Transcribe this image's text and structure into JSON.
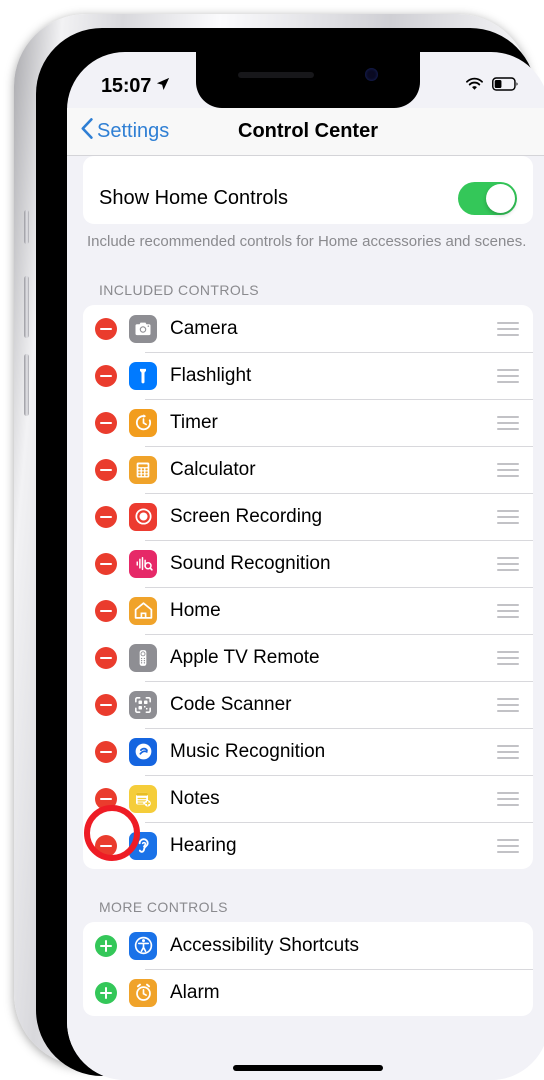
{
  "status_bar": {
    "time": "15:07",
    "location_icon": "location-arrow-icon",
    "wifi_icon": "wifi-icon",
    "battery_icon": "battery-icon",
    "battery_level_pct": 32
  },
  "nav": {
    "back_label": "Settings",
    "back_icon": "chevron-left-icon",
    "title": "Control Center"
  },
  "home_controls": {
    "label": "Show Home Controls",
    "toggle_state": "on",
    "toggle_color": "#34c759",
    "footer": "Include recommended controls for Home accessories and scenes."
  },
  "included_controls": {
    "header": "INCLUDED CONTROLS",
    "items": [
      {
        "label": "Camera",
        "icon": "camera-icon",
        "icon_color": "#8e8e93",
        "action": "remove"
      },
      {
        "label": "Flashlight",
        "icon": "flashlight-icon",
        "icon_color": "#007aff",
        "action": "remove"
      },
      {
        "label": "Timer",
        "icon": "timer-icon",
        "icon_color": "#f29d1e",
        "action": "remove"
      },
      {
        "label": "Calculator",
        "icon": "calculator-icon",
        "icon_color": "#f0a32a",
        "action": "remove"
      },
      {
        "label": "Screen Recording",
        "icon": "screen-recording-icon",
        "icon_color": "#ec3b30",
        "action": "remove"
      },
      {
        "label": "Sound Recognition",
        "icon": "sound-recognition-icon",
        "icon_color": "#e62968",
        "action": "remove"
      },
      {
        "label": "Home",
        "icon": "home-icon",
        "icon_color": "#f0a32a",
        "action": "remove"
      },
      {
        "label": "Apple TV Remote",
        "icon": "apple-tv-remote-icon",
        "icon_color": "#8e8e93",
        "action": "remove"
      },
      {
        "label": "Code Scanner",
        "icon": "code-scanner-icon",
        "icon_color": "#8e8e93",
        "action": "remove"
      },
      {
        "label": "Music Recognition",
        "icon": "music-recognition-icon",
        "icon_color": "#1565e0",
        "action": "remove"
      },
      {
        "label": "Notes",
        "icon": "notes-icon",
        "icon_color": "#f5cd3a",
        "action": "remove"
      },
      {
        "label": "Hearing",
        "icon": "hearing-icon",
        "icon_color": "#1a72e8",
        "action": "remove",
        "highlighted": true
      }
    ]
  },
  "more_controls": {
    "header": "MORE CONTROLS",
    "items": [
      {
        "label": "Accessibility Shortcuts",
        "icon": "accessibility-icon",
        "icon_color": "#1a72e8",
        "action": "add"
      },
      {
        "label": "Alarm",
        "icon": "alarm-icon",
        "icon_color": "#f0a32a",
        "action": "add"
      }
    ]
  },
  "annotation": {
    "highlight_color": "#ee1c25",
    "target": "Hearing"
  }
}
